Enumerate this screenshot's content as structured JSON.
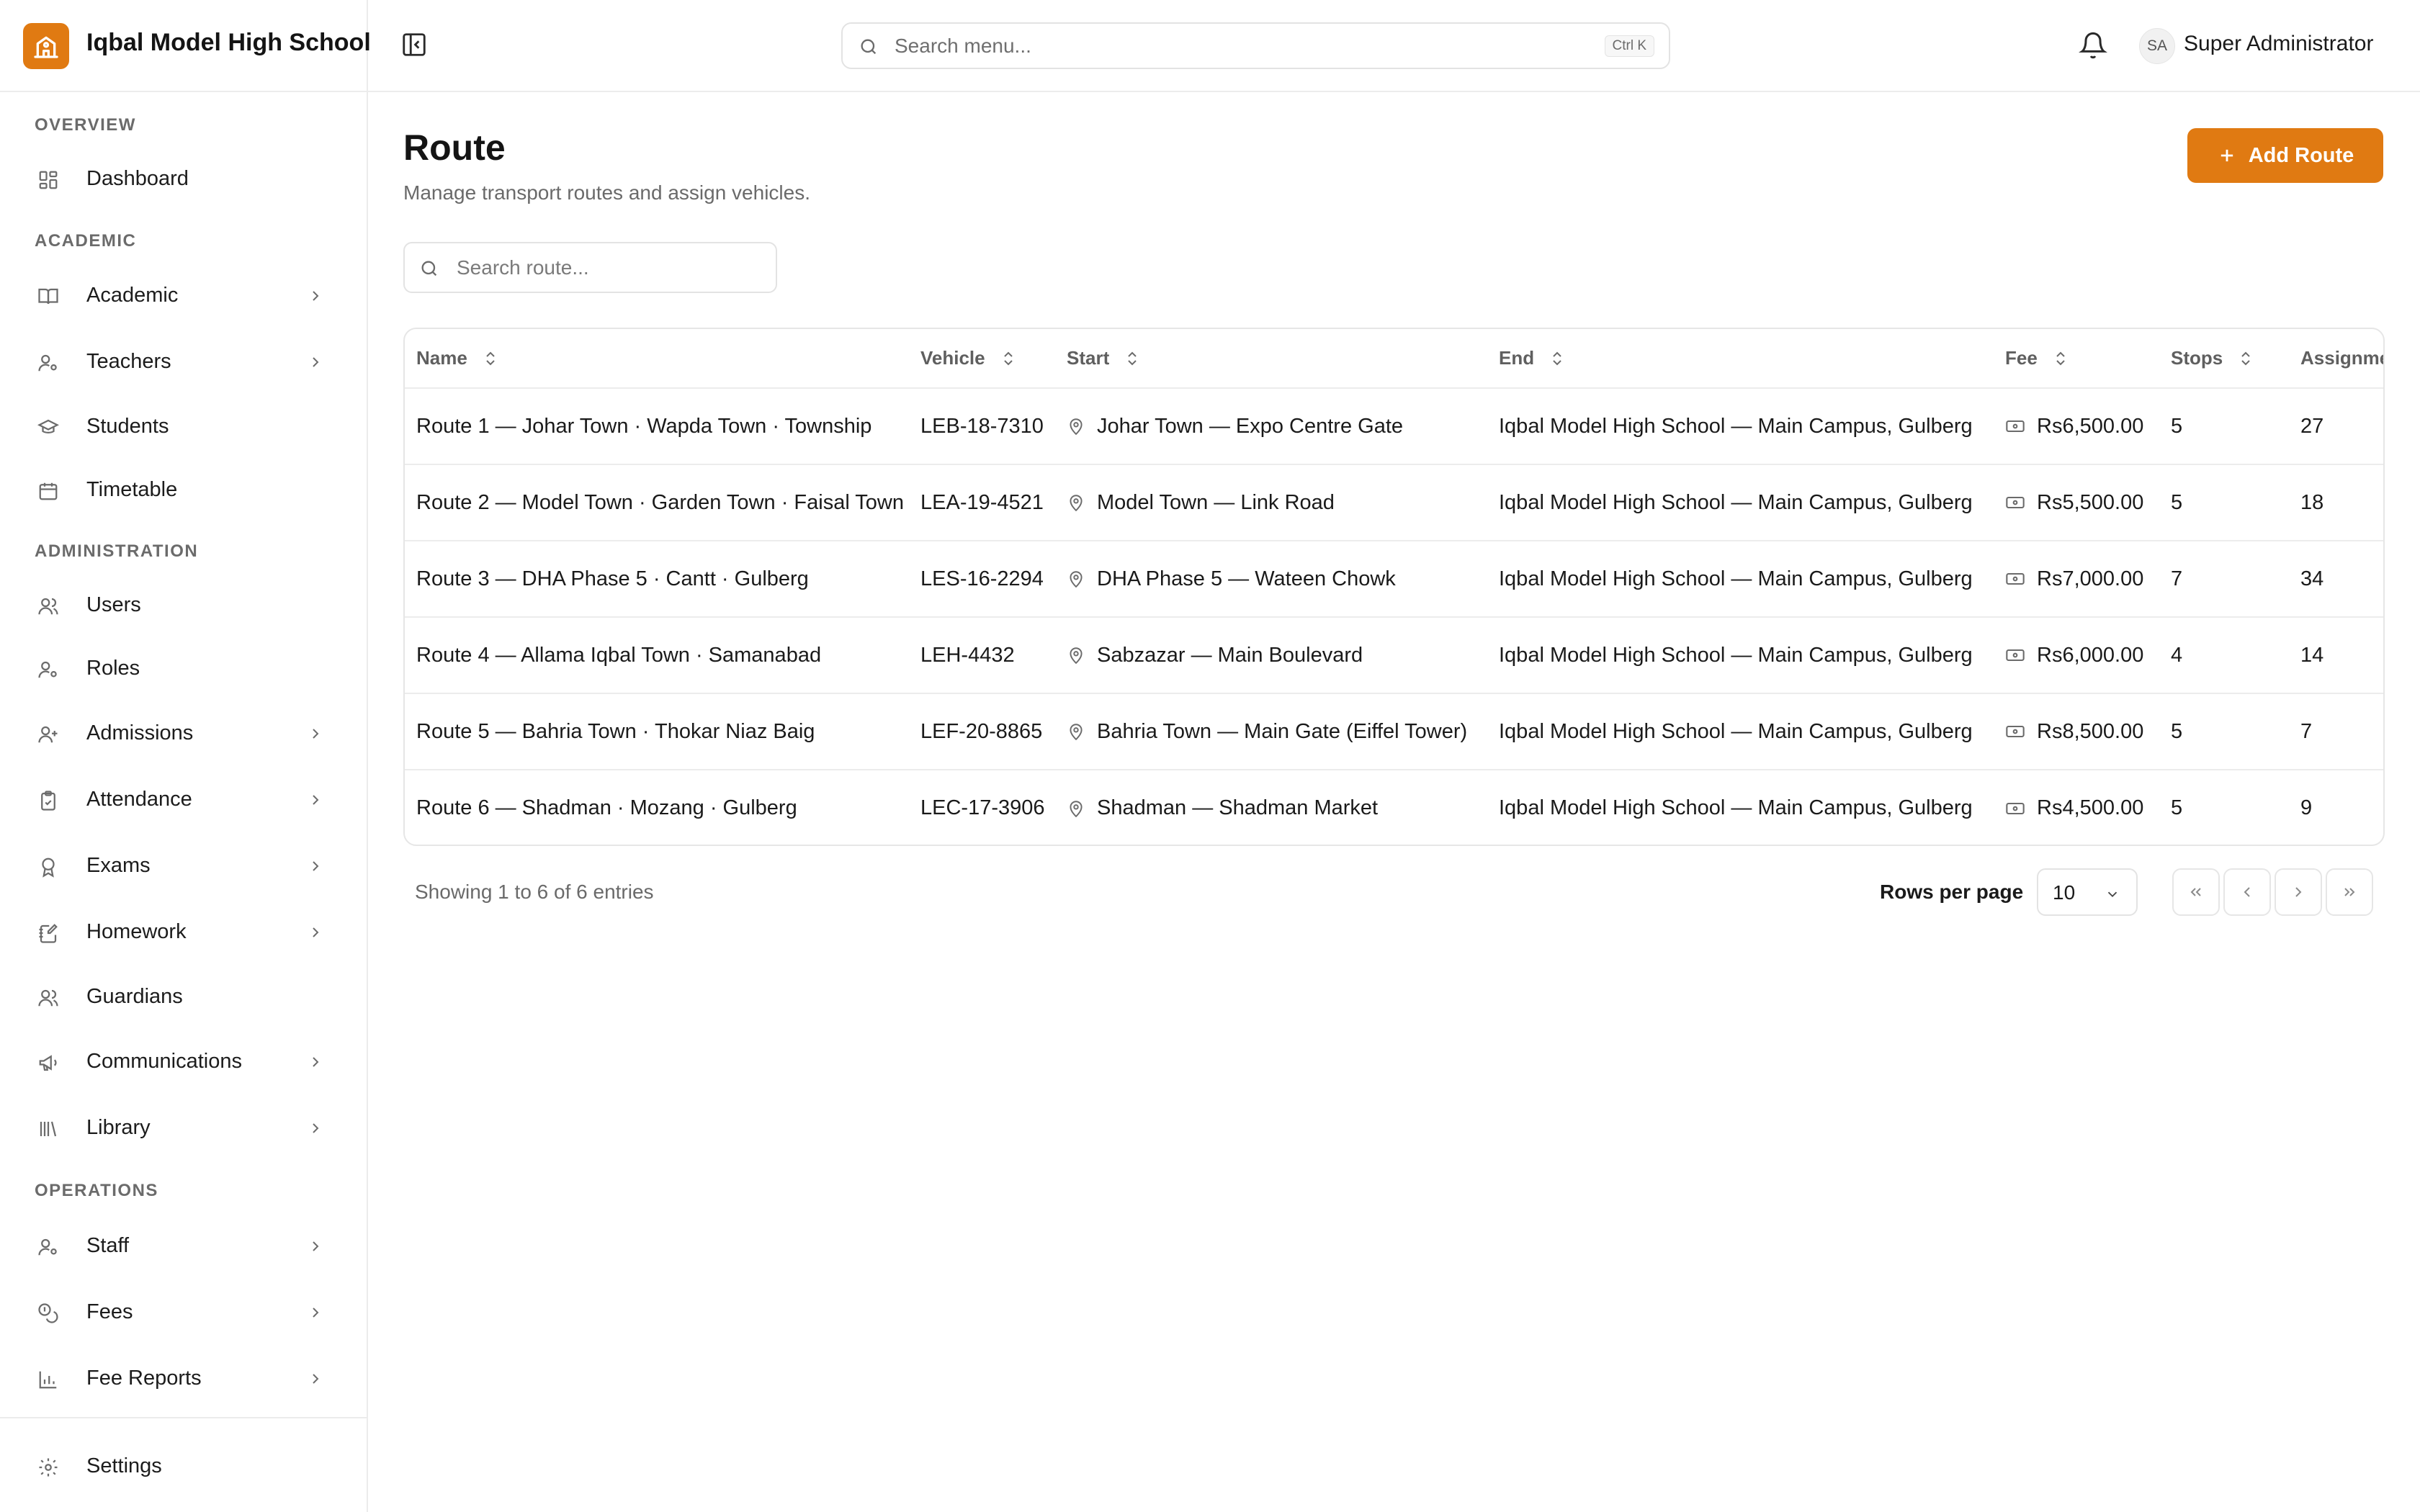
{
  "app": {
    "name": "Iqbal Model High School"
  },
  "header": {
    "search_placeholder": "Search menu...",
    "search_shortcut": "Ctrl K",
    "user_initials": "SA",
    "user_name": "Super Administrator"
  },
  "sidebar": {
    "sections": {
      "overview": "OVERVIEW",
      "academic": "ACADEMIC",
      "administration": "ADMINISTRATION",
      "operations": "OPERATIONS"
    },
    "items": {
      "dashboard": "Dashboard",
      "academic": "Academic",
      "teachers": "Teachers",
      "students": "Students",
      "timetable": "Timetable",
      "users": "Users",
      "roles": "Roles",
      "admissions": "Admissions",
      "attendance": "Attendance",
      "exams": "Exams",
      "homework": "Homework",
      "guardians": "Guardians",
      "communications": "Communications",
      "library": "Library",
      "staff": "Staff",
      "fees": "Fees",
      "fee_reports": "Fee Reports",
      "settings": "Settings"
    }
  },
  "page": {
    "title": "Route",
    "subtitle": "Manage transport routes and assign vehicles.",
    "add_button": "Add Route",
    "search_placeholder": "Search route..."
  },
  "table": {
    "columns": {
      "name": "Name",
      "vehicle": "Vehicle",
      "start": "Start",
      "end": "End",
      "fee": "Fee",
      "stops": "Stops",
      "assigned": "Assignme"
    },
    "rows": [
      {
        "name": "Route 1 —  Johar Town · Wapda Town · Township",
        "vehicle": "LEB-18-7310",
        "start": "Johar Town —  Expo Centre Gate",
        "end": "Iqbal Model High School —  Main Campus, Gulberg",
        "fee": "Rs6,500.00",
        "stops": "5",
        "assigned": "27"
      },
      {
        "name": "Route 2 —  Model Town · Garden Town · Faisal Town",
        "vehicle": "LEA-19-4521",
        "start": "Model Town —  Link Road",
        "end": "Iqbal Model High School —  Main Campus, Gulberg",
        "fee": "Rs5,500.00",
        "stops": "5",
        "assigned": "18"
      },
      {
        "name": "Route 3 —  DHA Phase 5 · Cantt · Gulberg",
        "vehicle": "LES-16-2294",
        "start": "DHA Phase 5 —  Wateen Chowk",
        "end": "Iqbal Model High School —  Main Campus, Gulberg",
        "fee": "Rs7,000.00",
        "stops": "7",
        "assigned": "34"
      },
      {
        "name": "Route 4 —  Allama Iqbal Town · Samanabad",
        "vehicle": "LEH-4432",
        "start": "Sabzazar —  Main Boulevard",
        "end": "Iqbal Model High School —  Main Campus, Gulberg",
        "fee": "Rs6,000.00",
        "stops": "4",
        "assigned": "14"
      },
      {
        "name": "Route 5 —  Bahria Town · Thokar Niaz Baig",
        "vehicle": "LEF-20-8865",
        "start": "Bahria Town —  Main Gate (Eiffel Tower)",
        "end": "Iqbal Model High School —  Main Campus, Gulberg",
        "fee": "Rs8,500.00",
        "stops": "5",
        "assigned": "7"
      },
      {
        "name": "Route 6 —  Shadman · Mozang · Gulberg",
        "vehicle": "LEC-17-3906",
        "start": "Shadman —  Shadman Market",
        "end": "Iqbal Model High School —  Main Campus, Gulberg",
        "fee": "Rs4,500.00",
        "stops": "5",
        "assigned": "9"
      }
    ]
  },
  "pagination": {
    "showing": "Showing 1 to 6 of 6 entries",
    "rows_per_page_label": "Rows per page",
    "rows_per_page": "10"
  },
  "colors": {
    "accent": "#e07a12",
    "border": "#ececec",
    "muted_text": "#6a6a6a"
  }
}
